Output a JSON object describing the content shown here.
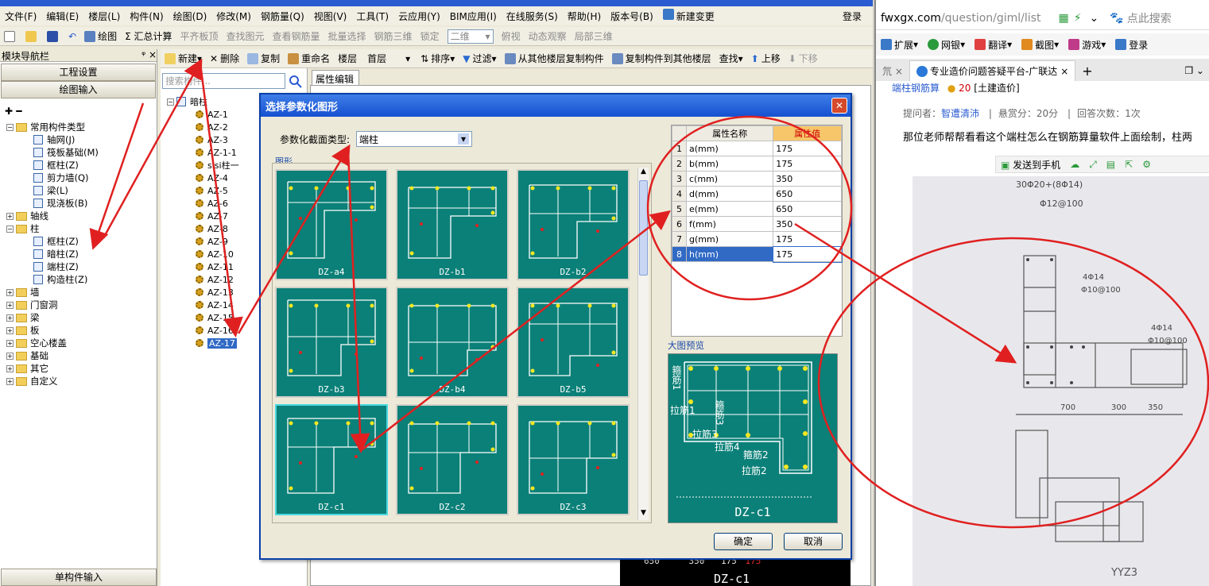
{
  "menubar": {
    "items": [
      "文件(F)",
      "编辑(E)",
      "楼层(L)",
      "构件(N)",
      "绘图(D)",
      "修改(M)",
      "钢筋量(Q)",
      "视图(V)",
      "工具(T)",
      "云应用(Y)",
      "BIM应用(I)",
      "在线服务(S)",
      "帮助(H)",
      "版本号(B)",
      "新建变更"
    ],
    "login": "登录"
  },
  "toolbar1": {
    "draw": "绘图",
    "sum": "Σ 汇总计算",
    "items_disabled": [
      "平齐板顶",
      "查找图元",
      "查看钢筋量",
      "批量选择",
      "钢筋三维",
      "锁定"
    ],
    "view2d": "二维",
    "items2": [
      "俯视",
      "动态观察",
      "局部三维"
    ]
  },
  "leftnav": {
    "title": "模块导航栏",
    "pin": "ᵠ ×",
    "btn1": "工程设置",
    "btn2": "绘图输入",
    "bottom": "单构件输入",
    "tree": {
      "common": "常用构件类型",
      "common_children": [
        "轴网(J)",
        "筏板基础(M)",
        "框柱(Z)",
        "剪力墙(Q)",
        "梁(L)",
        "现浇板(B)"
      ],
      "axis": "轴线",
      "column": "柱",
      "column_children": [
        "框柱(Z)",
        "暗柱(Z)",
        "端柱(Z)",
        "构造柱(Z)"
      ],
      "others": [
        "墙",
        "门窗洞",
        "梁",
        "板",
        "空心楼盖",
        "基础",
        "其它",
        "自定义"
      ]
    }
  },
  "toolbar2": {
    "new": "新建",
    "delete": "删除",
    "copy": "复制",
    "rename": "重命名",
    "floor_label": "楼层",
    "floor_value": "首层",
    "sort": "排序",
    "filter": "过滤",
    "copy_from": "从其他楼层复制构件",
    "copy_to": "复制构件到其他楼层",
    "find": "查找",
    "up": "上移",
    "down": "下移"
  },
  "search": {
    "placeholder": "搜索构件..."
  },
  "component_tree": {
    "root": "暗柱",
    "items": [
      "AZ-1",
      "AZ-2",
      "AZ-3",
      "AZ-1-1",
      "sisi柱一",
      "AZ-4",
      "AZ-5",
      "AZ-6",
      "AZ-7",
      "AZ-8",
      "AZ-9",
      "AZ-10",
      "AZ-11",
      "AZ-12",
      "AZ-13",
      "AZ-14",
      "AZ-15",
      "AZ-16",
      "AZ-17"
    ],
    "selected": "AZ-17"
  },
  "prop_tab": "属性编辑",
  "dialog": {
    "title": "选择参数化图形",
    "type_label": "参数化截面类型:",
    "type_value": "端柱",
    "shapes_label": "图形",
    "tiles": [
      "DZ-a4",
      "DZ-b1",
      "DZ-b2",
      "DZ-b3",
      "DZ-b4",
      "DZ-b5",
      "DZ-c1",
      "DZ-c2",
      "DZ-c3"
    ],
    "selected_tile": "DZ-c1",
    "table": {
      "headers": [
        "属性名称",
        "属性值"
      ],
      "rows": [
        {
          "no": "1",
          "name": "a(mm)",
          "value": "175"
        },
        {
          "no": "2",
          "name": "b(mm)",
          "value": "175"
        },
        {
          "no": "3",
          "name": "c(mm)",
          "value": "350"
        },
        {
          "no": "4",
          "name": "d(mm)",
          "value": "650"
        },
        {
          "no": "5",
          "name": "e(mm)",
          "value": "650"
        },
        {
          "no": "6",
          "name": "f(mm)",
          "value": "350"
        },
        {
          "no": "7",
          "name": "g(mm)",
          "value": "175"
        },
        {
          "no": "8",
          "name": "h(mm)",
          "value": "175"
        }
      ]
    },
    "preview_label": "大图预览",
    "preview_caption": "DZ-c1",
    "preview_labels": [
      "箍筋1",
      "拉筋1",
      "箍筋3",
      "拉筋3",
      "拉筋4",
      "箍筋2",
      "拉筋2"
    ],
    "ok": "确定",
    "cancel": "取消"
  },
  "bottom_dims": {
    "d1": "650",
    "d2": "350",
    "d3": "175",
    "d4": "175",
    "caption": "DZ-c1"
  },
  "browser": {
    "url_domain": "fwxgx.com",
    "url_path": "/question/giml/list",
    "search_hint": "点此搜索",
    "toolbar": [
      "扩展",
      "网银",
      "翻译",
      "截图",
      "游戏",
      "登录"
    ],
    "tab_title": "专业造价问题答疑平台-广联达",
    "breadcrumb": "端柱钢筋算",
    "score_badge": "20",
    "category": "[土建造价]",
    "asker_label": "提问者：",
    "asker": "智遭清沛",
    "reward": "悬赏分：20分",
    "answers": "回答次数：1次",
    "question": "那位老师帮帮看看这个端柱怎么在钢筋算量软件上面绘制，柱两",
    "send_phone": "发送到手机",
    "photo_texts": [
      "30Φ20+(8Φ14)",
      "Φ12@100",
      "4Φ14",
      "Φ10@100",
      "4Φ14",
      "Φ10@100",
      "700",
      "300",
      "350",
      "YYZ3"
    ]
  }
}
